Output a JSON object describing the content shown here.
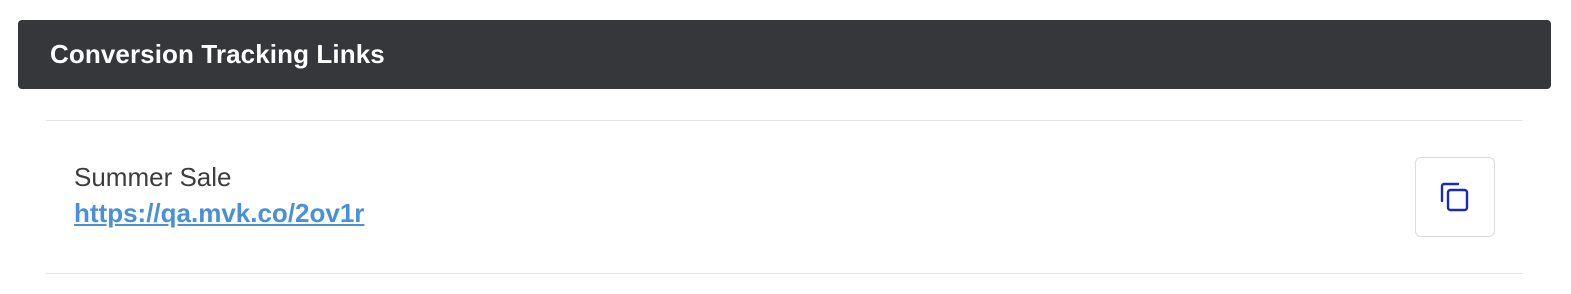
{
  "panel": {
    "title": "Conversion Tracking Links"
  },
  "links": [
    {
      "name": "Summer Sale",
      "url": "https://qa.mvk.co/2ov1r"
    }
  ],
  "copy_button": {
    "icon": "copy-icon",
    "icon_color": "#1a2ab8"
  },
  "colors": {
    "header_bg": "#36373b",
    "link": "#4a90d9"
  }
}
